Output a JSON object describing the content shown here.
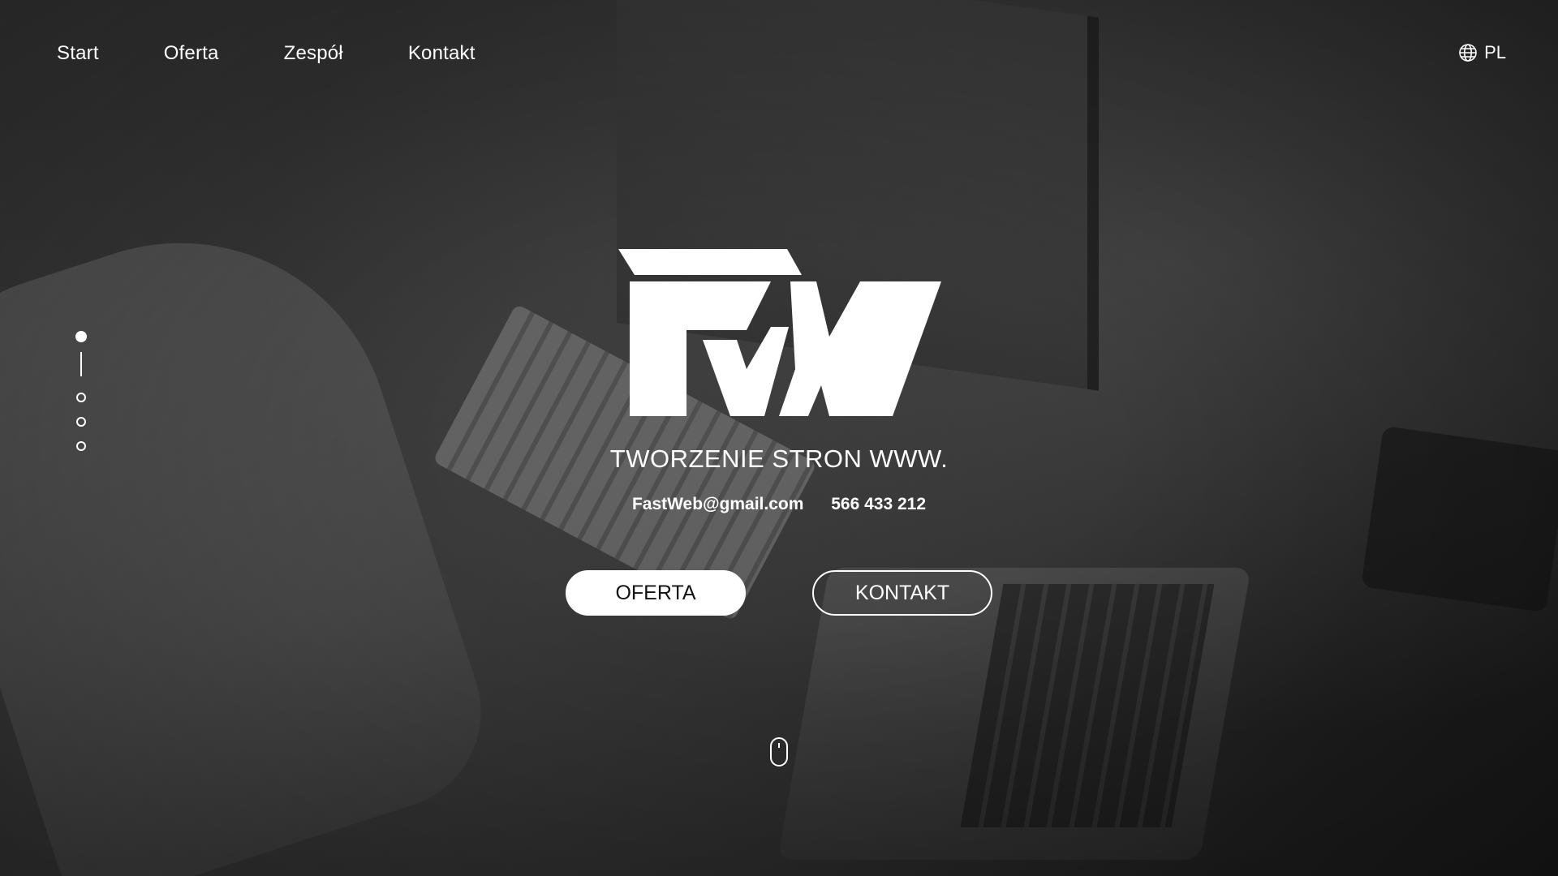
{
  "nav": {
    "items": [
      {
        "label": "Start"
      },
      {
        "label": "Oferta"
      },
      {
        "label": "Zespół"
      },
      {
        "label": "Kontakt"
      }
    ]
  },
  "language": {
    "icon": "globe-icon",
    "label": "PL"
  },
  "slides": {
    "count": 4,
    "active_index": 0
  },
  "hero": {
    "logo_icon": "fw-logo",
    "tagline": "TWORZENIE STRON WWW.",
    "email": "FastWeb@gmail.com",
    "phone": "566 433 212",
    "primary_button": "OFERTA",
    "secondary_button": "KONTAKT",
    "scroll_icon": "mouse-scroll-icon"
  },
  "colors": {
    "text": "#ffffff",
    "primary_button_bg": "#ffffff",
    "primary_button_text": "#111111",
    "overlay": "#2b2b2b"
  }
}
